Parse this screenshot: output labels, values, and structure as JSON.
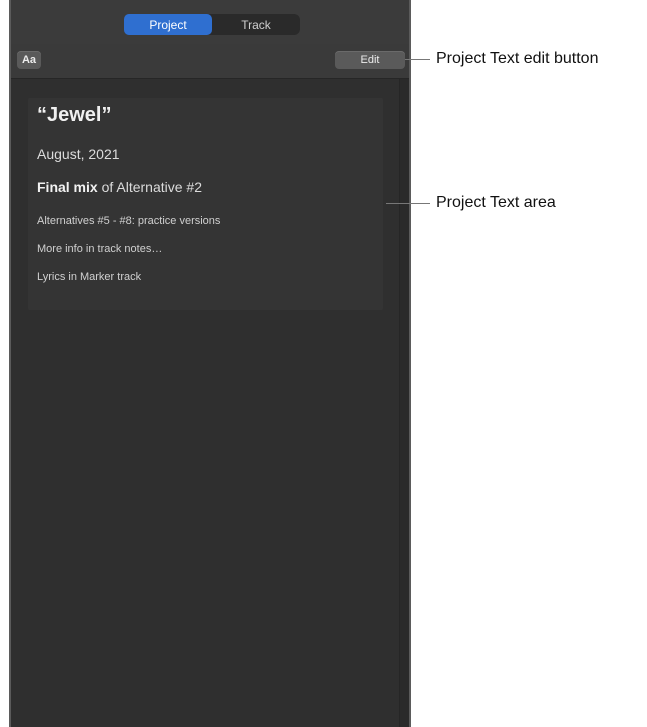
{
  "tabs": {
    "project_label": "Project",
    "track_label": "Track"
  },
  "toolbar": {
    "font_button_label": "Aa",
    "edit_button_label": "Edit"
  },
  "project_text": {
    "title": "“Jewel”",
    "date": "August, 2021",
    "mix_bold": "Final mix",
    "mix_rest": " of Alternative #2",
    "alternatives": "Alternatives #5 - #8: practice versions",
    "more_info": "More info in track notes…",
    "lyrics": "Lyrics in Marker track"
  },
  "callouts": {
    "edit_button": "Project Text edit button",
    "text_area": "Project Text area"
  },
  "colors": {
    "accent": "#2f6fd0",
    "panel_bg": "#333333"
  }
}
